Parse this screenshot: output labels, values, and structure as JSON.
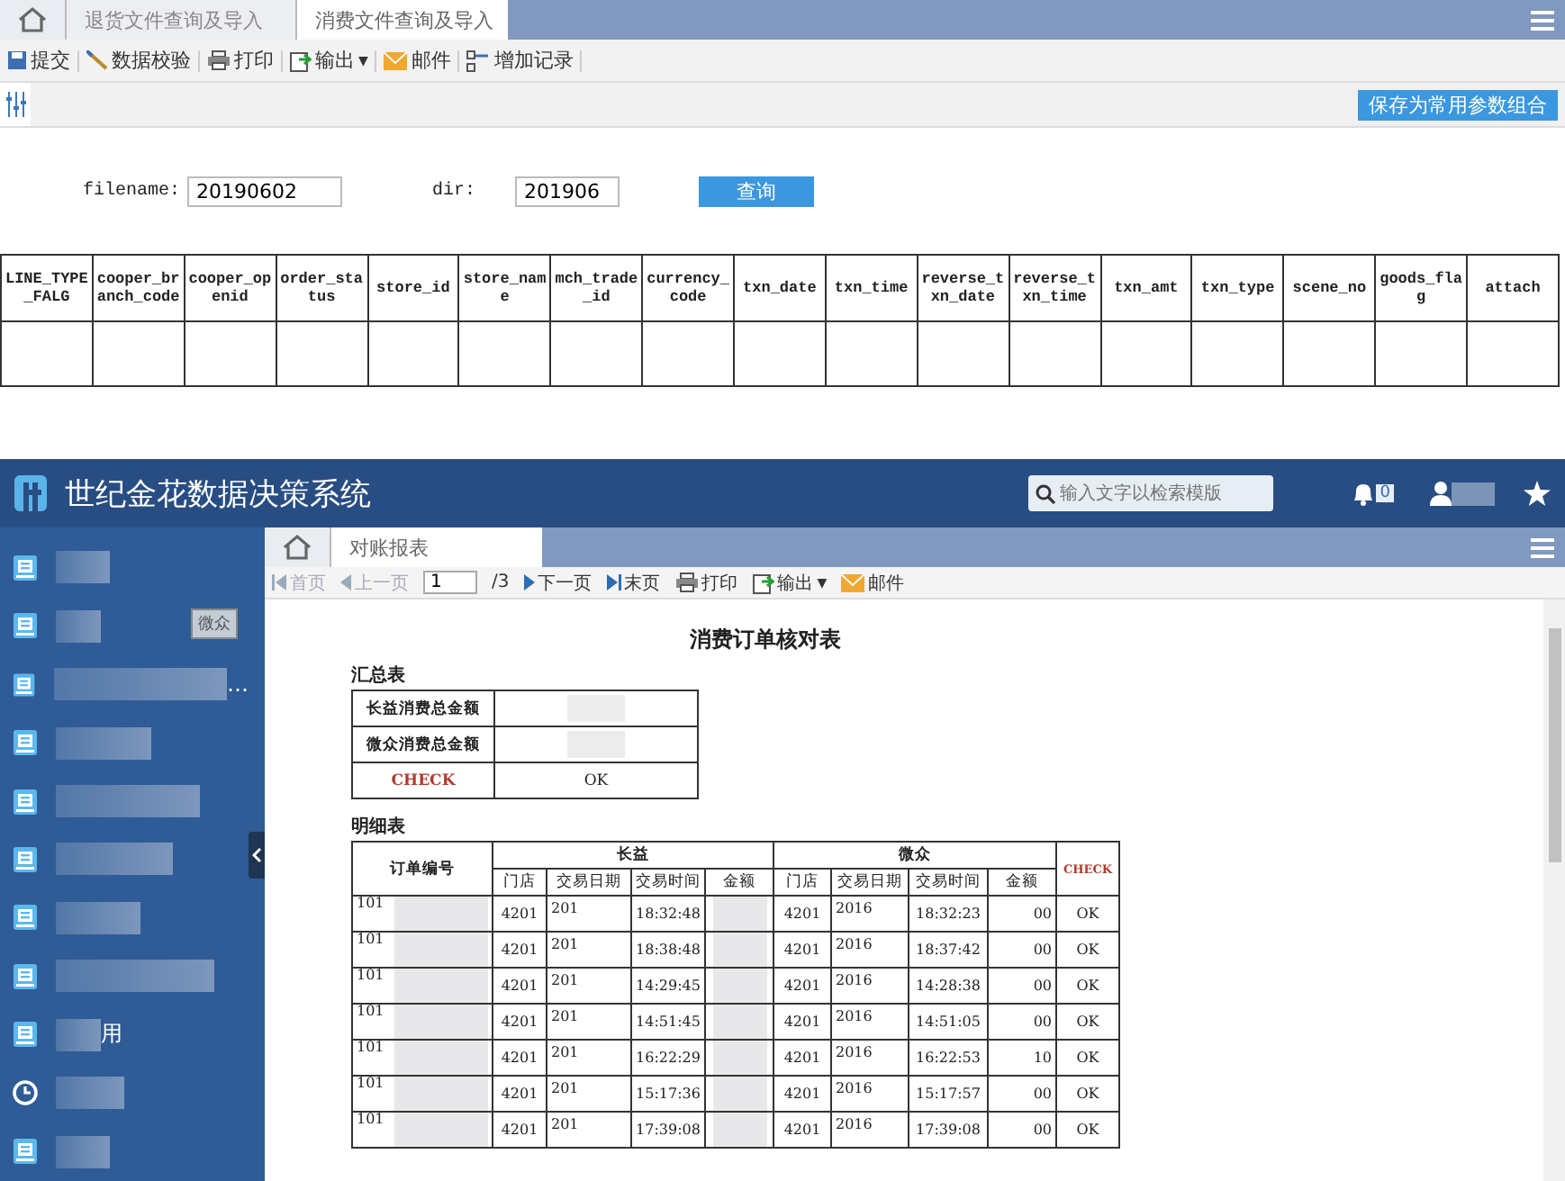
{
  "top_window": {
    "tabs": [
      {
        "label": "退货文件查询及导入",
        "selected": false
      },
      {
        "label": "消费文件查询及导入",
        "selected": true
      }
    ],
    "toolbar": [
      {
        "kind": "save",
        "label": "提交"
      },
      {
        "kind": "wand",
        "label": "数据校验"
      },
      {
        "kind": "print",
        "label": "打印"
      },
      {
        "kind": "export",
        "label": "输出",
        "caret": "▼"
      },
      {
        "kind": "mail",
        "label": "邮件"
      },
      {
        "kind": "add",
        "label": "增加记录"
      }
    ],
    "save_params_button": "保存为常用参数组合",
    "form": {
      "fields": [
        {
          "label": "filename:",
          "value": "20190602"
        },
        {
          "label": "dir:",
          "value": "201906"
        }
      ],
      "query_button": "查询"
    },
    "table": {
      "columns": [
        "LINE_TYPE_FALG",
        "cooper_branch_code",
        "cooper_openid",
        "order_status",
        "store_id",
        "store_name",
        "mch_trade_id",
        "currency_code",
        "txn_date",
        "txn_time",
        "reverse_txn_date",
        "reverse_txn_time",
        "txn_amt",
        "txn_type",
        "scene_no",
        "goods_flag",
        "attach"
      ]
    }
  },
  "bottom_window": {
    "app_title": "世纪金花数据决策系统",
    "search": {
      "placeholder": "输入文字以检索模版"
    },
    "notification_count": "0",
    "sidebar": {
      "items": [
        {
          "kind": "report"
        },
        {
          "kind": "report",
          "tooltip": "微众"
        },
        {
          "kind": "report",
          "label": "…"
        },
        {
          "kind": "report"
        },
        {
          "kind": "report"
        },
        {
          "kind": "report"
        },
        {
          "kind": "report"
        },
        {
          "kind": "report"
        },
        {
          "kind": "report",
          "label": "用"
        },
        {
          "kind": "clock"
        },
        {
          "kind": "report"
        }
      ]
    },
    "tabs": [
      {
        "label": "对账报表",
        "selected": true
      }
    ],
    "toolbar": [
      {
        "kind": "first",
        "label": "首页",
        "disabled": true
      },
      {
        "kind": "prev",
        "label": "上一页",
        "disabled": true
      },
      {
        "kind": "page",
        "value": "1"
      },
      {
        "kind": "total",
        "label": "/3"
      },
      {
        "kind": "next",
        "label": "下一页",
        "disabled": false
      },
      {
        "kind": "last",
        "label": "末页",
        "disabled": false
      },
      {
        "kind": "print",
        "label": "打印",
        "disabled": false
      },
      {
        "kind": "export",
        "label": "输出",
        "caret": "▼",
        "disabled": false
      },
      {
        "kind": "mail",
        "label": "邮件",
        "disabled": false
      }
    ],
    "report": {
      "title": "消费订单核对表",
      "summary": {
        "title": "汇总表",
        "rows": [
          {
            "kind": "amount",
            "label": "长益消费总金额"
          },
          {
            "kind": "amount",
            "label": "微众消费总金额"
          },
          {
            "kind": "check",
            "label": "CHECK",
            "value": "OK"
          }
        ]
      },
      "detail": {
        "title": "明细表",
        "order_header": "订单编号",
        "group_a": "长益",
        "group_b": "微众",
        "check_header": "CHECK",
        "sub_headers_a": [
          "门店",
          "交易日期",
          "交易时间",
          "金额"
        ],
        "sub_headers_b": [
          "门店",
          "交易日期",
          "交易时间",
          "金额"
        ],
        "rows": [
          {
            "order": "101",
            "store_a": "4201",
            "date_a": "201",
            "time_a": "18:32:48",
            "store_b": "4201",
            "date_b": "2016",
            "time_b": "18:32:23",
            "amount_b": "00",
            "check": "OK"
          },
          {
            "order": "101",
            "store_a": "4201",
            "date_a": "201",
            "time_a": "18:38:48",
            "store_b": "4201",
            "date_b": "2016",
            "time_b": "18:37:42",
            "amount_b": "00",
            "check": "OK"
          },
          {
            "order": "101",
            "store_a": "4201",
            "date_a": "201",
            "time_a": "14:29:45",
            "store_b": "4201",
            "date_b": "2016",
            "time_b": "14:28:38",
            "amount_b": "00",
            "check": "OK"
          },
          {
            "order": "101",
            "store_a": "4201",
            "date_a": "201",
            "time_a": "14:51:45",
            "store_b": "4201",
            "date_b": "2016",
            "time_b": "14:51:05",
            "amount_b": "00",
            "check": "OK"
          },
          {
            "order": "101",
            "store_a": "4201",
            "date_a": "201",
            "time_a": "16:22:29",
            "store_b": "4201",
            "date_b": "2016",
            "time_b": "16:22:53",
            "amount_b": "10",
            "check": "OK"
          },
          {
            "order": "101",
            "store_a": "4201",
            "date_a": "201",
            "time_a": "15:17:36",
            "store_b": "4201",
            "date_b": "2016",
            "time_b": "15:17:57",
            "amount_b": "00",
            "check": "OK"
          },
          {
            "order": "101",
            "store_a": "4201",
            "date_a": "201",
            "time_a": "17:39:08",
            "store_b": "4201",
            "date_b": "2016",
            "time_b": "17:39:08",
            "amount_b": "00",
            "check": "OK"
          }
        ]
      }
    }
  }
}
